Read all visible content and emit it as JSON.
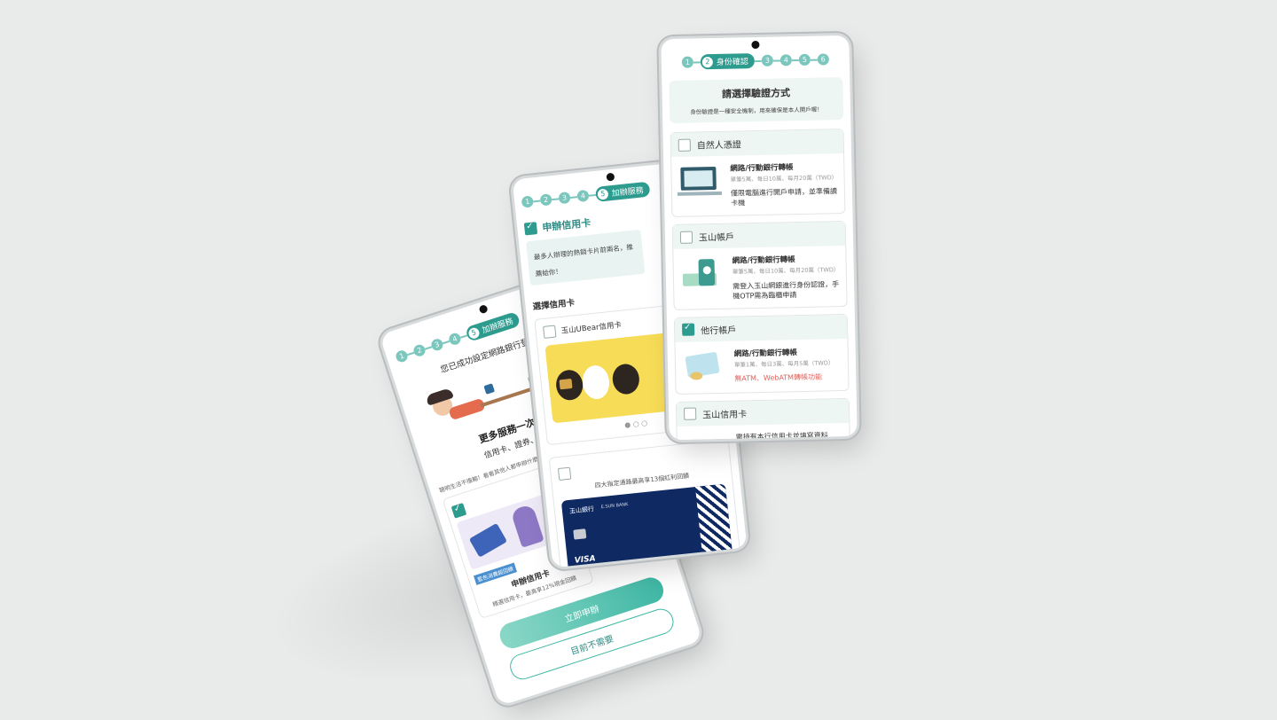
{
  "phone_a": {
    "steps": [
      "1",
      "2",
      "3",
      "4"
    ],
    "active_step": {
      "num": "5",
      "label": "加辦服務"
    },
    "banner_text": "您已成功設定網路銀行登入資料",
    "headline": "更多服務一次申辦！",
    "subline": "信用卡、證券、理財服務",
    "tip": "聰明生活不擔輸！看看其他人都申辦什麼",
    "tag": "藍色消費超回饋",
    "card_title": "申辦信用卡",
    "card_desc": "精選信用卡，最高享12%現金回饋",
    "apply_button": "立即申辦",
    "skip_button": "目前不需要"
  },
  "phone_b": {
    "steps": [
      "1",
      "2",
      "3",
      "4"
    ],
    "active_step": {
      "num": "5",
      "label": "加辦服務"
    },
    "section_title": "申辦信用卡",
    "speech": "最多人辦理的熱銷卡片前兩名，推薦給你！",
    "choose_label": "選擇信用卡",
    "card1_name": "玉山UBear信用卡",
    "card2_desc": "四大指定通路最高享13個紅利回饋",
    "bank_name": "玉山銀行",
    "bank_en": "E.SUN BANK",
    "card_brand": "VISA"
  },
  "phone_c": {
    "steps_before": [
      "1"
    ],
    "active_step": {
      "num": "2",
      "label": "身份確認"
    },
    "steps_after": [
      "3",
      "4",
      "5",
      "6"
    ],
    "title": "請選擇驗證方式",
    "subtitle": "身份驗證是一種安全機制，用來確保是本人開戶喔！",
    "methods": [
      {
        "name": "自然人憑證",
        "checked": false,
        "line1": "網路/行動銀行轉帳",
        "line2": "單筆5萬、每日10萬、每月20萬（TWD）",
        "note": "僅限電腦進行開戶申請，並準備讀卡機",
        "warn": ""
      },
      {
        "name": "玉山帳戶",
        "checked": false,
        "line1": "網路/行動銀行轉帳",
        "line2": "單筆5萬、每日10萬、每月20萬（TWD）",
        "note": "需登入玉山網銀進行身份認證，手機OTP需為臨櫃申請",
        "warn": ""
      },
      {
        "name": "他行帳戶",
        "checked": true,
        "line1": "網路/行動銀行轉帳",
        "line2": "單筆1萬、每日3萬、每月5萬（TWD）",
        "note": "",
        "warn": "無ATM、WebATM轉帳功能"
      },
      {
        "name": "玉山信用卡",
        "checked": false,
        "line1": "",
        "line2": "",
        "note": "需持有本行信用卡並填寫資料",
        "warn": ""
      }
    ]
  },
  "colors": {
    "accent": "#2e9b8f",
    "accent_light": "#7bc6bd",
    "warn": "#e2615b",
    "card_yellow": "#f7dc57",
    "card_navy": "#0f2a63"
  }
}
